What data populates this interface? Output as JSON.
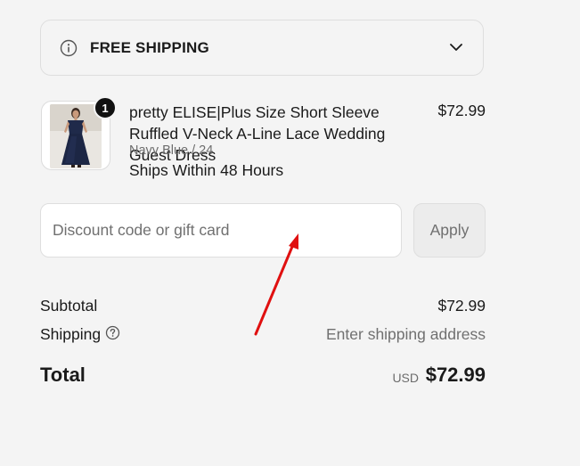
{
  "shipping_banner": {
    "label": "FREE SHIPPING",
    "info_icon": "info-icon",
    "toggle_icon": "chevron-down-icon"
  },
  "cart_item": {
    "quantity": "1",
    "title": "pretty ELISE|Plus Size Short Sleeve Ruffled V-Neck A-Line Lace Wedding Guest Dress",
    "variant": "Navy Blue / 24",
    "shipping_note": "Ships Within 48 Hours",
    "price": "$72.99",
    "image_alt": "Navy blue lace dress"
  },
  "discount": {
    "placeholder": "Discount code or gift card",
    "value": "",
    "apply_label": "Apply"
  },
  "summary": {
    "subtotal_label": "Subtotal",
    "subtotal_value": "$72.99",
    "shipping_label": "Shipping",
    "shipping_help_icon": "question-circle-icon",
    "shipping_value": "Enter shipping address",
    "total_label": "Total",
    "total_currency": "USD",
    "total_value": "$72.99"
  },
  "colors": {
    "background": "#f4f4f4",
    "border": "#dedede",
    "text": "#1a1a1a",
    "muted_text": "#707070",
    "badge": "#111111",
    "annotation_arrow": "#e01010"
  }
}
